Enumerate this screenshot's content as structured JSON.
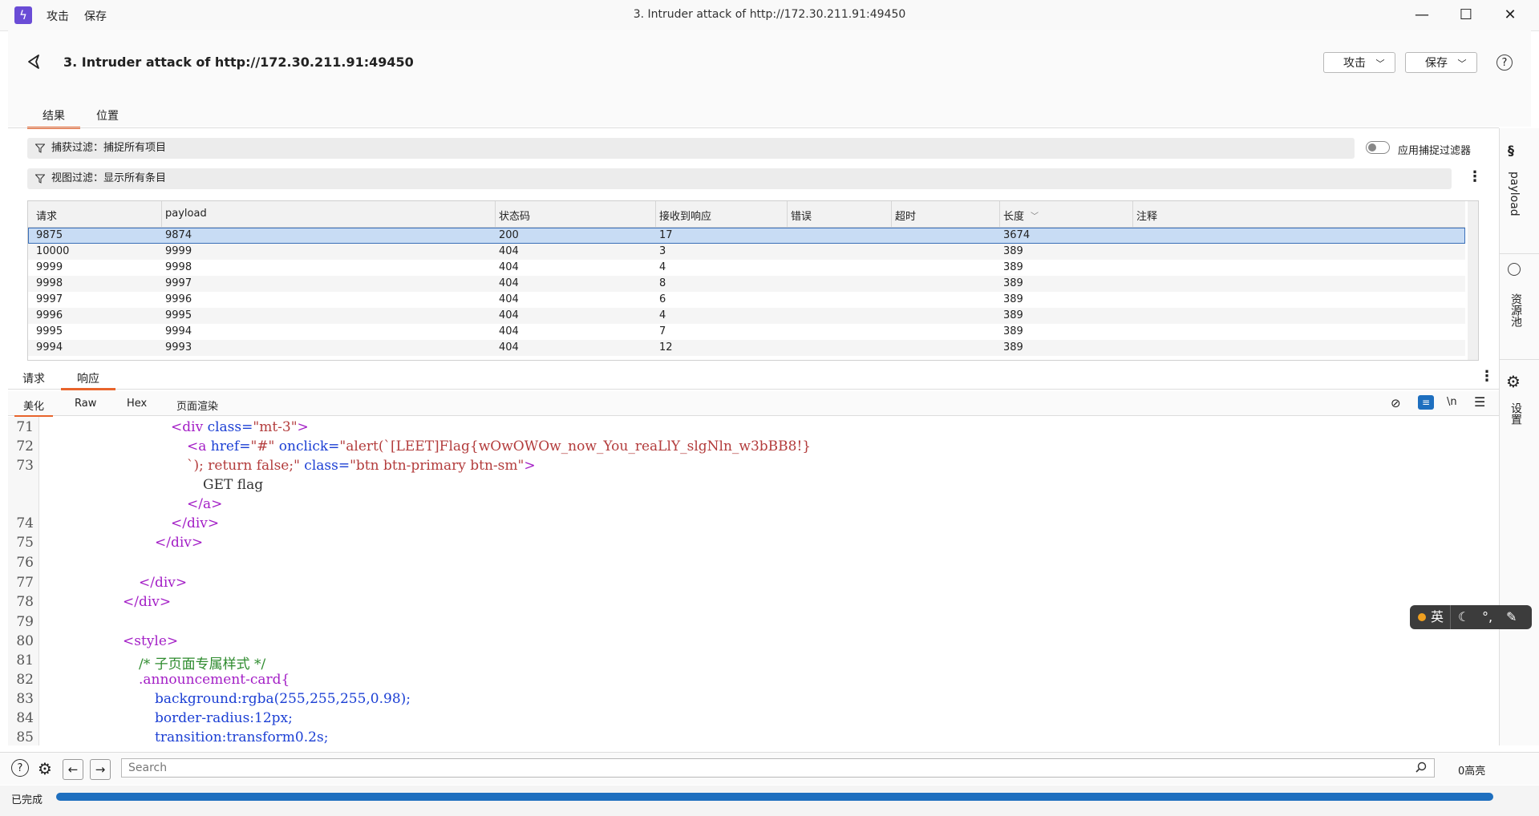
{
  "window": {
    "title": "3. Intruder attack of http://172.30.211.91:49450",
    "menu": [
      "攻击",
      "保存"
    ],
    "controls": {
      "minimize": "—",
      "maximize": "☐",
      "close": "✕"
    }
  },
  "header": {
    "title": "3. Intruder attack of http://172.30.211.91:49450",
    "attack_button": "攻击",
    "save_button": "保存",
    "help": "?"
  },
  "tabs": [
    {
      "label": "结果",
      "active": true
    },
    {
      "label": "位置",
      "active": false
    }
  ],
  "filters": {
    "capture_filter": "捕获过滤：捕捉所有项目",
    "apply_capture_filter": "应用捕捉过滤器",
    "view_filter": "视图过滤：显示所有条目"
  },
  "table": {
    "columns": [
      "请求",
      "payload",
      "状态码",
      "接收到响应",
      "错误",
      "超时",
      "长度",
      "注释"
    ],
    "rows": [
      [
        "9875",
        "9874",
        "200",
        "17",
        "",
        "",
        "3674",
        ""
      ],
      [
        "10000",
        "9999",
        "404",
        "3",
        "",
        "",
        "389",
        ""
      ],
      [
        "9999",
        "9998",
        "404",
        "4",
        "",
        "",
        "389",
        ""
      ],
      [
        "9998",
        "9997",
        "404",
        "8",
        "",
        "",
        "389",
        ""
      ],
      [
        "9997",
        "9996",
        "404",
        "6",
        "",
        "",
        "389",
        ""
      ],
      [
        "9996",
        "9995",
        "404",
        "4",
        "",
        "",
        "389",
        ""
      ],
      [
        "9995",
        "9994",
        "404",
        "7",
        "",
        "",
        "389",
        ""
      ],
      [
        "9994",
        "9993",
        "404",
        "12",
        "",
        "",
        "389",
        ""
      ]
    ],
    "selected_row": 0,
    "sorted_column": "长度"
  },
  "response_tabs": [
    {
      "label": "请求",
      "active": false
    },
    {
      "label": "响应",
      "active": true
    }
  ],
  "view_tabs": [
    {
      "label": "美化",
      "active": true
    },
    {
      "label": "Raw",
      "active": false
    },
    {
      "label": "Hex",
      "active": false
    },
    {
      "label": "页面渲染",
      "active": false
    }
  ],
  "editor_tools": {
    "newline": "\\n"
  },
  "code": {
    "line_numbers": [
      "71",
      "72",
      "73",
      "",
      "",
      "74",
      "75",
      "76",
      "77",
      "78",
      "79",
      "80",
      "81",
      "82",
      "83",
      "84",
      "85"
    ],
    "l71_tag_open": "<div ",
    "l71_attr": "class=",
    "l71_val": "\"mt-3\"",
    "l71_close": ">",
    "l72_tag": "<a ",
    "l72_attr1": "href=",
    "l72_val1": "\"#\"",
    "l72_attr2": " onclick=",
    "l72_val2": "\"alert(`[LEET]Flag{wOwOWOw_now_You_reaLlY_slgNln_w3bBB8!}",
    "l73_val": "`); return false;\"",
    "l73_attr": " class=",
    "l73_val2": "\"btn btn-primary btn-sm\"",
    "l73_close": ">",
    "l73b_text": "GET flag",
    "l73c_tag": "</a>",
    "l74_tag": "</div>",
    "l75_tag": "</div>",
    "l77_tag": "</div>",
    "l78_tag": "</div>",
    "l80_tag": "<style>",
    "l81_cmt": "/* 子页面专属样式 */",
    "l82_sel": ".announcement-card{",
    "l83_prop": "background:",
    "l83_val": "rgba(255,255,255,0.98);",
    "l84_prop": "border-radius:",
    "l84_val": "12px;",
    "l85_prop": "transition:",
    "l85_val": "transform0.2s;"
  },
  "sidebar": {
    "payload": "payload",
    "resource_pool": "资源池",
    "settings": "设置"
  },
  "bottom": {
    "search_placeholder": "Search",
    "highlights": "0高亮"
  },
  "status": {
    "text": "已完成",
    "progress": 1.0
  },
  "ime": {
    "lang": "英"
  }
}
